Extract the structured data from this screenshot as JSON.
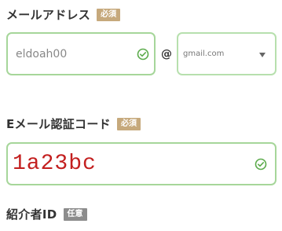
{
  "email_section": {
    "label": "メールアドレス",
    "required_badge": "必須",
    "local_part_value": "eldoah00",
    "at_symbol": "@",
    "domain_value": "gmail.com"
  },
  "code_section": {
    "label": "Eメール認証コード",
    "required_badge": "必須",
    "code_value": "1a23bc"
  },
  "referrer_section": {
    "label": "紹介者ID",
    "optional_badge": "任意"
  },
  "colors": {
    "field_border": "#a6d69a",
    "check_green": "#5cab4c",
    "required_badge_bg": "#c6a97c",
    "optional_badge_bg": "#8c8c8c",
    "code_text": "#c31f1f"
  },
  "icons": {
    "valid": "check-circle-icon",
    "select": "chevron-down-icon"
  }
}
